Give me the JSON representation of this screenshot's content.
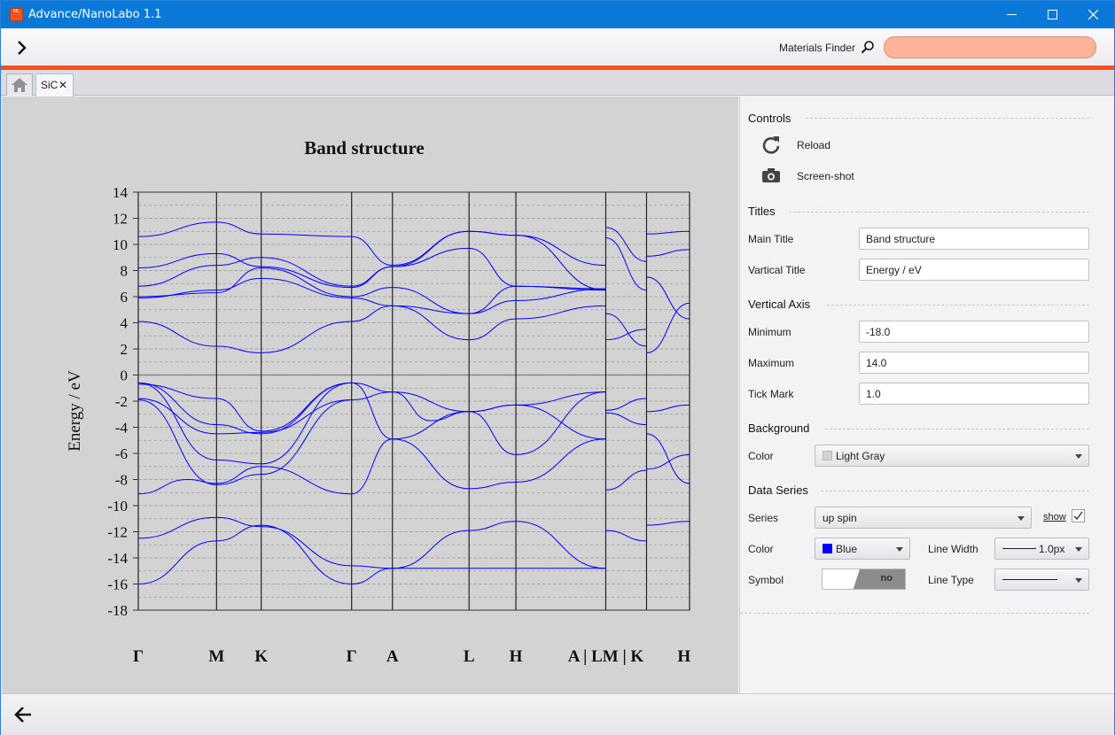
{
  "window": {
    "title": "Advance/NanoLabo 1.1"
  },
  "toolbar": {
    "finder_label": "Materials Finder",
    "finder_value": ""
  },
  "tabs": [
    {
      "label": "SiC",
      "close": "✕"
    }
  ],
  "chart_data": {
    "type": "line",
    "title": "Band structure",
    "ylabel": "Energy / eV",
    "xlabel": "",
    "ylim": [
      -18,
      14
    ],
    "grid": true,
    "tick_mark": 1.0,
    "y_ticks": [
      14,
      12,
      10,
      8,
      6,
      4,
      2,
      0,
      -2,
      -4,
      -6,
      -8,
      -10,
      -12,
      -14,
      -16,
      -18
    ],
    "kpoint_labels": [
      "Γ",
      "M",
      "K",
      "Γ",
      "A",
      "L",
      "H",
      "A | LM | K",
      "H"
    ],
    "kpoint_positions": [
      0,
      0.142,
      0.223,
      0.387,
      0.461,
      0.6,
      0.685,
      0.848,
      0.922,
      1.0
    ],
    "series": [
      {
        "name": "up spin",
        "color": "#0000ff",
        "bands": [
          [
            [
              0,
              -16
            ],
            [
              0.142,
              -12.7
            ],
            [
              0.223,
              -11.5
            ],
            [
              0.387,
              -16
            ],
            [
              0.461,
              -14.8
            ],
            [
              0.848,
              -14.8
            ]
          ],
          [
            [
              0,
              -12.5
            ],
            [
              0.142,
              -10.9
            ],
            [
              0.223,
              -11.6
            ],
            [
              0.387,
              -14.6
            ],
            [
              0.461,
              -14.8
            ],
            [
              0.6,
              -11.9
            ],
            [
              0.685,
              -11.2
            ],
            [
              0.848,
              -14.8
            ]
          ],
          [
            [
              0,
              -9.1
            ],
            [
              0.09,
              -8
            ],
            [
              0.142,
              -8.3
            ],
            [
              0.223,
              -7
            ],
            [
              0.387,
              -9.1
            ],
            [
              0.461,
              -4.9
            ],
            [
              0.6,
              -8.7
            ],
            [
              0.685,
              -8.2
            ],
            [
              0.848,
              -4.9
            ]
          ],
          [
            [
              0,
              -1.9
            ],
            [
              0.142,
              -8.4
            ],
            [
              0.223,
              -7.6
            ],
            [
              0.387,
              -1.9
            ],
            [
              0.461,
              -1.3
            ],
            [
              0.6,
              -2.8
            ],
            [
              0.685,
              -6.1
            ],
            [
              0.848,
              -1.3
            ]
          ],
          [
            [
              0,
              -0.6
            ],
            [
              0.142,
              -6.5
            ],
            [
              0.223,
              -6.8
            ],
            [
              0.387,
              -0.6
            ],
            [
              0.461,
              -1.3
            ],
            [
              0.53,
              -3.5
            ],
            [
              0.6,
              -2.8
            ],
            [
              0.685,
              -2.3
            ],
            [
              0.848,
              -4.9
            ]
          ],
          [
            [
              0,
              -0.6
            ],
            [
              0.142,
              -3.8
            ],
            [
              0.223,
              -4.5
            ],
            [
              0.387,
              -0.6
            ],
            [
              0.461,
              -4.9
            ],
            [
              0.6,
              -2.8
            ],
            [
              0.685,
              -2.3
            ],
            [
              0.848,
              -1.3
            ]
          ],
          [
            [
              0,
              -0.7
            ],
            [
              0.142,
              -1.8
            ],
            [
              0.223,
              -4.3
            ],
            [
              0.387,
              -0.6
            ]
          ],
          [
            [
              0,
              -1.8
            ],
            [
              0.142,
              -4.5
            ],
            [
              0.223,
              -4.4
            ],
            [
              0.387,
              -1.9
            ]
          ],
          [
            [
              0,
              4.1
            ],
            [
              0.142,
              2.2
            ],
            [
              0.223,
              1.7
            ],
            [
              0.387,
              4.1
            ],
            [
              0.461,
              5.3
            ],
            [
              0.6,
              2.7
            ],
            [
              0.685,
              4.3
            ],
            [
              0.848,
              5.3
            ]
          ],
          [
            [
              0,
              5.9
            ],
            [
              0.142,
              6.5
            ],
            [
              0.223,
              7.4
            ],
            [
              0.387,
              5.9
            ],
            [
              0.461,
              5.3
            ],
            [
              0.6,
              4.7
            ],
            [
              0.685,
              5.7
            ],
            [
              0.848,
              6.6
            ]
          ],
          [
            [
              0,
              6
            ],
            [
              0.142,
              6.3
            ],
            [
              0.223,
              8.2
            ],
            [
              0.387,
              6
            ],
            [
              0.461,
              6.7
            ],
            [
              0.6,
              4.7
            ],
            [
              0.685,
              6.8
            ],
            [
              0.848,
              6.6
            ]
          ],
          [
            [
              0,
              6.8
            ],
            [
              0.142,
              8.4
            ],
            [
              0.223,
              9
            ],
            [
              0.387,
              6.8
            ],
            [
              0.461,
              8.3
            ],
            [
              0.6,
              9.7
            ],
            [
              0.685,
              6.8
            ],
            [
              0.848,
              6.5
            ]
          ],
          [
            [
              0,
              8.2
            ],
            [
              0.142,
              9.3
            ],
            [
              0.223,
              8.3
            ],
            [
              0.387,
              6.7
            ],
            [
              0.461,
              8.3
            ],
            [
              0.6,
              11
            ],
            [
              0.685,
              10.7
            ],
            [
              0.848,
              6.5
            ]
          ],
          [
            [
              0,
              10.6
            ],
            [
              0.142,
              11.7
            ],
            [
              0.223,
              10.8
            ],
            [
              0.387,
              10.6
            ],
            [
              0.461,
              8.4
            ],
            [
              0.6,
              11
            ],
            [
              0.685,
              10.7
            ],
            [
              0.848,
              8.4
            ]
          ]
        ]
      }
    ],
    "segments_right": [
      [
        [
          0.848,
          4.7
        ],
        [
          0.922,
          2.2
        ]
      ],
      [
        [
          0.848,
          2.7
        ],
        [
          0.922,
          3.5
        ]
      ],
      [
        [
          0.848,
          10.5
        ],
        [
          0.922,
          6.5
        ]
      ],
      [
        [
          0.848,
          11.3
        ],
        [
          0.922,
          8.7
        ]
      ],
      [
        [
          0.922,
          1.7
        ],
        [
          1,
          5.5
        ]
      ],
      [
        [
          0.922,
          7.5
        ],
        [
          1,
          4.3
        ]
      ],
      [
        [
          0.922,
          9.1
        ],
        [
          1,
          9.6
        ]
      ],
      [
        [
          0.922,
          10.8
        ],
        [
          1,
          11
        ]
      ],
      [
        [
          0.848,
          -2.9
        ],
        [
          0.922,
          -3.8
        ]
      ],
      [
        [
          0.848,
          -2.7
        ],
        [
          0.922,
          -1.8
        ]
      ],
      [
        [
          0.848,
          -8.8
        ],
        [
          0.922,
          -7.3
        ]
      ],
      [
        [
          0.848,
          -11.9
        ],
        [
          0.922,
          -12.7
        ]
      ],
      [
        [
          0.922,
          -4.5
        ],
        [
          1,
          -8.3
        ]
      ],
      [
        [
          0.922,
          -7.2
        ],
        [
          1,
          -6.1
        ]
      ],
      [
        [
          0.922,
          -2.8
        ],
        [
          1,
          -2.3
        ]
      ],
      [
        [
          0.922,
          -11.5
        ],
        [
          1,
          -11.2
        ]
      ]
    ]
  },
  "controls": {
    "section": "Controls",
    "reload": "Reload",
    "screenshot": "Screen-shot"
  },
  "titles": {
    "section": "Titles",
    "main_label": "Main Title",
    "main_value": "Band structure",
    "vert_label": "Vartical Title",
    "vert_value": "Energy / eV"
  },
  "vaxis": {
    "section": "Vertical Axis",
    "min_label": "Minimum",
    "min_value": "-18.0",
    "max_label": "Maximum",
    "max_value": "14.0",
    "tick_label": "Tick Mark",
    "tick_value": "1.0"
  },
  "background": {
    "section": "Background",
    "color_label": "Color",
    "color_value": "Light Gray",
    "swatch": "#d3d3d3"
  },
  "dataseries": {
    "section": "Data Series",
    "series_label": "Series",
    "series_value": "up spin",
    "show_label": "show",
    "show_checked": true,
    "color_label": "Color",
    "color_value": "Blue",
    "swatch": "#0000ff",
    "linewidth_label": "Line Width",
    "linewidth_value": "1.0px",
    "symbol_label": "Symbol",
    "symbol_value": "no",
    "linetype_label": "Line Type"
  }
}
